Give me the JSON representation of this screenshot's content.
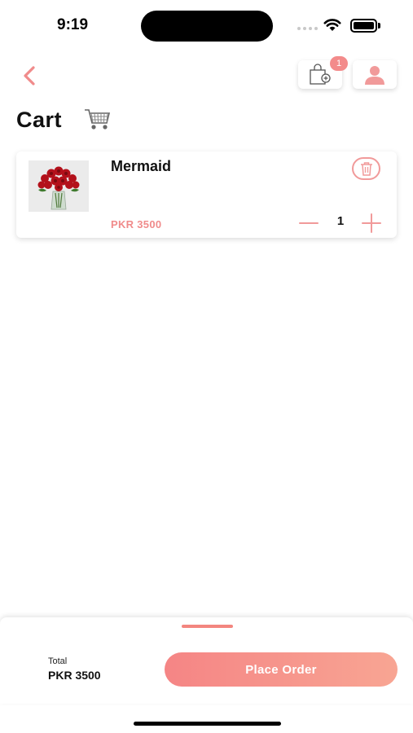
{
  "status_bar": {
    "time": "9:19"
  },
  "header": {
    "back_icon": "chevron-left-icon",
    "cart_icon": "shopping-bag-icon",
    "cart_badge": "1",
    "profile_icon": "user-icon"
  },
  "page": {
    "title": "Cart",
    "title_icon": "shopping-cart-icon"
  },
  "cart_items": [
    {
      "name": "Mermaid",
      "price": "PKR 3500",
      "quantity": "1",
      "image": "red-roses-bouquet",
      "delete_icon": "trash-icon"
    }
  ],
  "footer": {
    "total_label": "Total",
    "total_value": "PKR 3500",
    "place_order_label": "Place Order"
  },
  "colors": {
    "accent": "#f08b8b",
    "button_gradient_start": "#f58585",
    "button_gradient_end": "#f8a593"
  }
}
